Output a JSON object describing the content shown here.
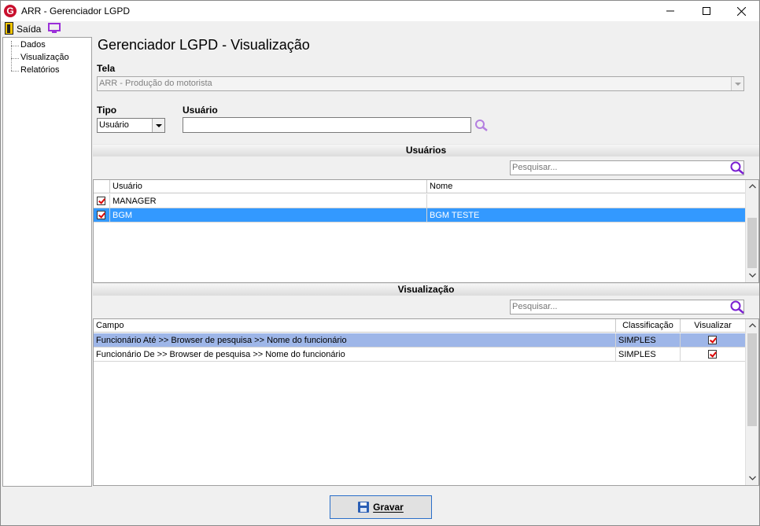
{
  "window": {
    "title": "ARR - Gerenciador LGPD",
    "app_icon_letter": "G"
  },
  "toolbar": {
    "exit_label": "Saída"
  },
  "tree": {
    "items": [
      {
        "label": "Dados"
      },
      {
        "label": "Visualização"
      },
      {
        "label": "Relatórios"
      }
    ]
  },
  "page": {
    "title": "Gerenciador LGPD - Visualização",
    "tela_label": "Tela",
    "tela_value": "ARR - Produção do motorista",
    "tipo_label": "Tipo",
    "tipo_value": "Usuário",
    "usuario_label": "Usuário",
    "usuario_value": ""
  },
  "users_section": {
    "title": "Usuários",
    "search_placeholder": "Pesquisar...",
    "columns": [
      "Usuário",
      "Nome"
    ],
    "rows": [
      {
        "usuario": "MANAGER",
        "nome": "",
        "checked": true,
        "selected": false
      },
      {
        "usuario": "BGM",
        "nome": "BGM TESTE",
        "checked": true,
        "selected": true
      }
    ]
  },
  "view_section": {
    "title": "Visualização",
    "search_placeholder": "Pesquisar...",
    "columns": [
      "Campo",
      "Classificação",
      "Visualizar"
    ],
    "rows": [
      {
        "campo": "Funcionário Até >> Browser de pesquisa >> Nome do funcionário",
        "classificacao": "SIMPLES",
        "visualizar": true,
        "selected": true
      },
      {
        "campo": "Funcionário De >> Browser de pesquisa >> Nome do funcionário",
        "classificacao": "SIMPLES",
        "visualizar": true,
        "selected": false
      }
    ]
  },
  "footer": {
    "save_label": "Gravar"
  },
  "colors": {
    "accent": "#3399ff",
    "selection_light": "#9eb6e8",
    "search_icon": "#9b30d9",
    "brand": "#c8102e"
  }
}
